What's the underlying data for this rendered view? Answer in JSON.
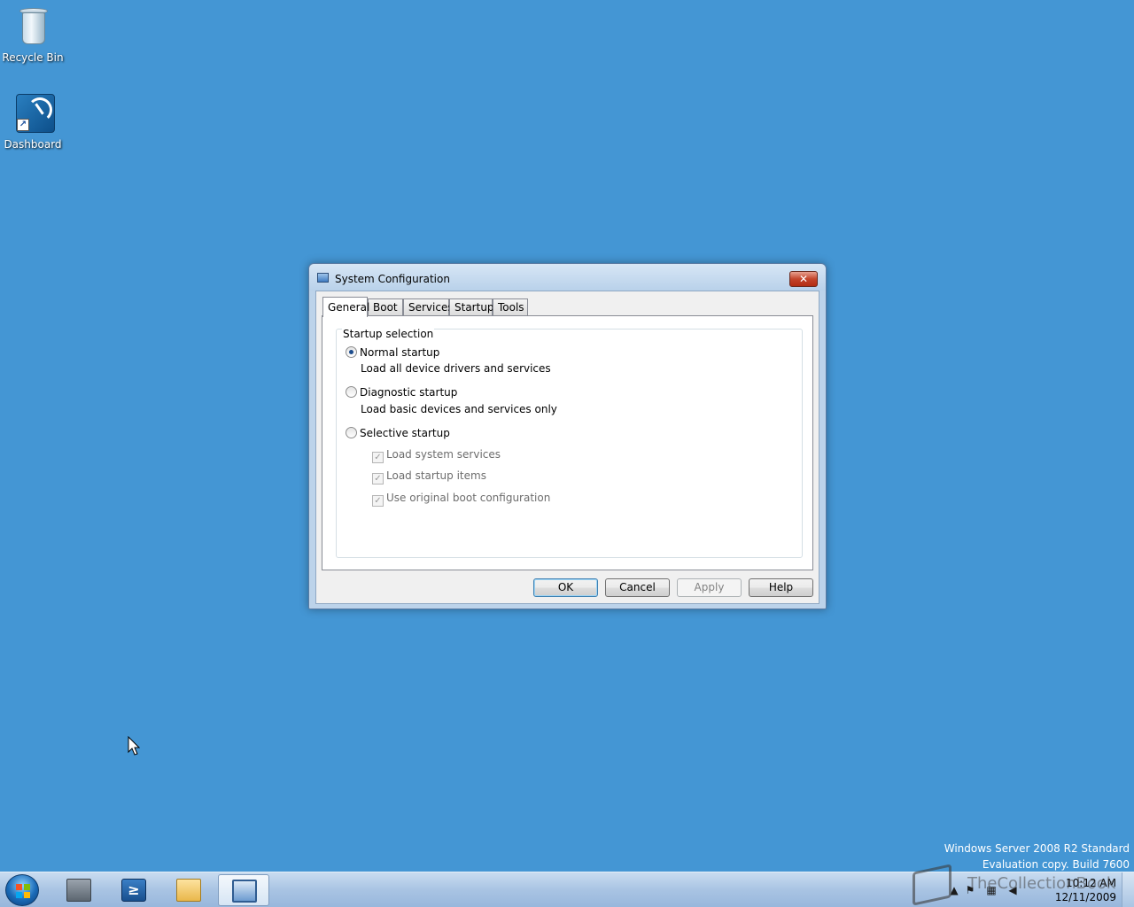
{
  "desktop": {
    "icons": [
      {
        "label": "Recycle Bin"
      },
      {
        "label": "Dashboard"
      }
    ],
    "os_info": {
      "line1": "Windows Server 2008 R2 Standard",
      "line2": "Evaluation copy. Build 7600"
    }
  },
  "dialog": {
    "title": "System Configuration",
    "close_label": "✕",
    "tabs": [
      {
        "label": "General",
        "active": true
      },
      {
        "label": "Boot"
      },
      {
        "label": "Services"
      },
      {
        "label": "Startup"
      },
      {
        "label": "Tools"
      }
    ],
    "group_label": "Startup selection",
    "options": [
      {
        "label": "Normal startup",
        "description": "Load all device drivers and services",
        "checked": true
      },
      {
        "label": "Diagnostic startup",
        "description": "Load basic devices and services only",
        "checked": false
      },
      {
        "label": "Selective startup",
        "checked": false
      }
    ],
    "checkboxes": [
      {
        "label": "Load system services",
        "checked": true,
        "enabled": false
      },
      {
        "label": "Load startup items",
        "checked": true,
        "enabled": false
      },
      {
        "label": "Use original boot configuration",
        "checked": true,
        "enabled": false
      }
    ],
    "buttons": {
      "ok": "OK",
      "cancel": "Cancel",
      "apply": "Apply",
      "help": "Help"
    }
  },
  "taskbar": {
    "clock_time": "10:12 AM",
    "clock_date": "12/11/2009",
    "powershell_glyph": "≥"
  },
  "watermark": {
    "text": "TheCollectionBook"
  },
  "icons": {
    "recycle": "recycle-bin-icon",
    "dashboard": "dashboard-icon",
    "start": "windows-start-icon",
    "tray_flag": "action-center-flag-icon",
    "tray_network": "network-icon",
    "tray_volume": "volume-muted-icon"
  },
  "colors": {
    "desktop": "#4496d4",
    "dialog_frame": "#bcd3ea",
    "close_button": "#c4452c"
  }
}
